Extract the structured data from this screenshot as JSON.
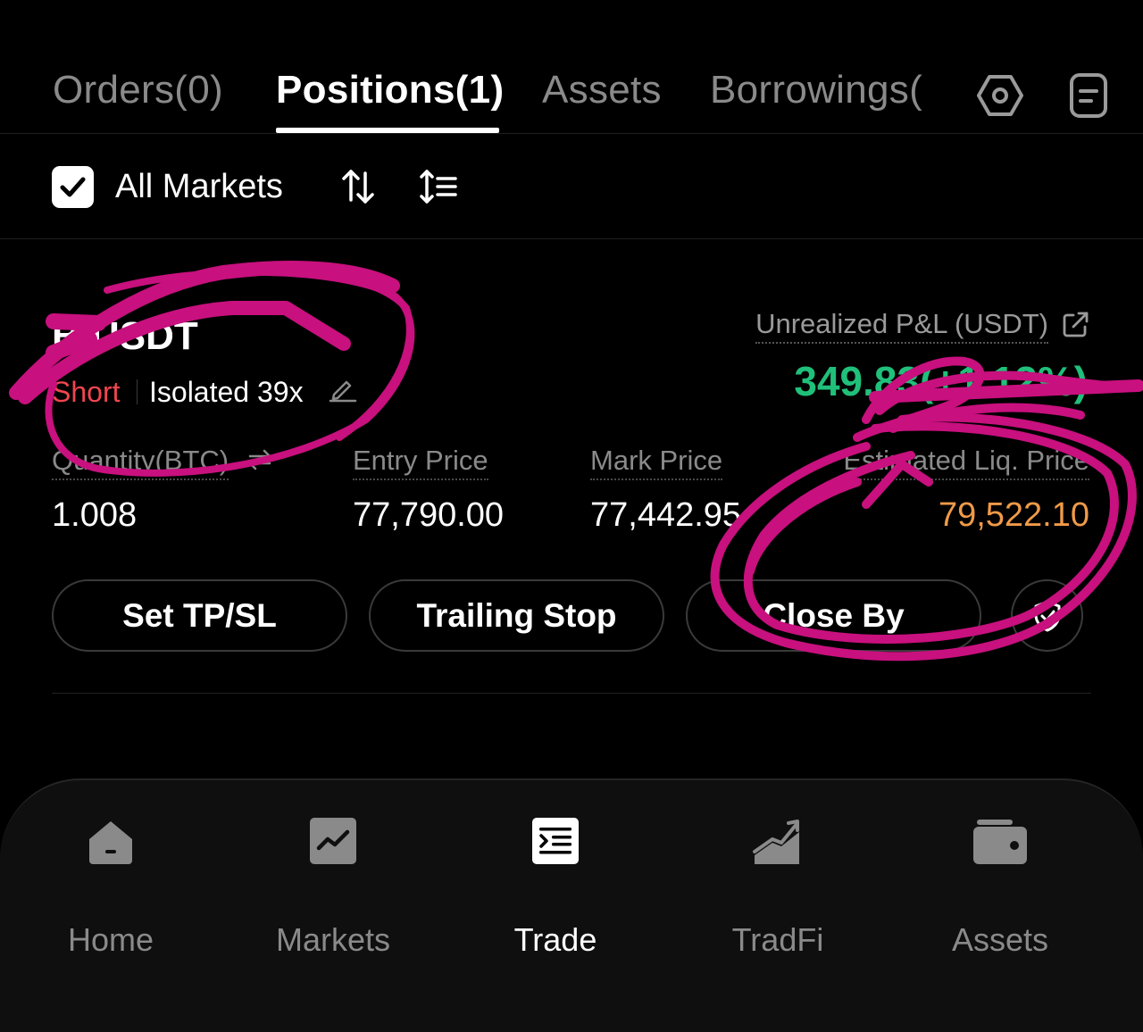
{
  "tabs": [
    {
      "label": "Orders(0)"
    },
    {
      "label": "Positions(1)",
      "active": true
    },
    {
      "label": "Assets"
    },
    {
      "label": "Borrowings("
    }
  ],
  "tab_icons": [
    "settings-hexagon-icon",
    "document-list-icon"
  ],
  "filter": {
    "checked": true,
    "label": "All Markets",
    "icons": [
      "sort-arrows-icon",
      "filter-list-icon"
    ]
  },
  "position": {
    "symbol": "B  USDT",
    "side": "Short",
    "margin_mode": "Isolated 39x",
    "pnl_label": "Unrealized P&L (USDT)",
    "pnl_value": "349.83(+1.12%)",
    "fields": [
      {
        "label": "Quantity(BTC)",
        "value": "1.008"
      },
      {
        "label": "Entry Price",
        "value": "77,790.00"
      },
      {
        "label": "Mark Price",
        "value": "77,442.95"
      },
      {
        "label": "Estimated Liq. Price",
        "value": "79,522.10"
      }
    ],
    "buttons": [
      "Set TP/SL",
      "Trailing Stop",
      "Close By"
    ]
  },
  "nav": [
    {
      "label": "Home",
      "icon": "home-icon"
    },
    {
      "label": "Markets",
      "icon": "markets-chart-icon"
    },
    {
      "label": "Trade",
      "icon": "trade-icon",
      "active": true
    },
    {
      "label": "TradFi",
      "icon": "tradfi-icon"
    },
    {
      "label": "Assets",
      "icon": "wallet-icon"
    }
  ],
  "colors": {
    "short": "#f0464f",
    "pnl_positive": "#20c07a",
    "liq_price": "#f09a48",
    "annotation": "#c8107e"
  }
}
